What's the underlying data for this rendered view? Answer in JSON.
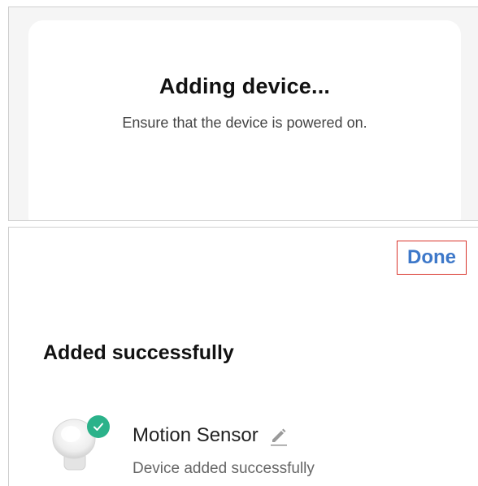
{
  "adding_screen": {
    "title": "Adding device...",
    "subtitle": "Ensure that the device is powered on."
  },
  "success_screen": {
    "done_label": "Done",
    "heading": "Added successfully",
    "device": {
      "name": "Motion Sensor",
      "status": "Device added successfully",
      "image_icon": "motion-sensor-image",
      "badge_icon": "check-icon",
      "edit_icon": "pencil-icon"
    }
  },
  "colors": {
    "accent": "#3d78c9",
    "success": "#2bb28a",
    "highlight_border": "#d9342b"
  }
}
